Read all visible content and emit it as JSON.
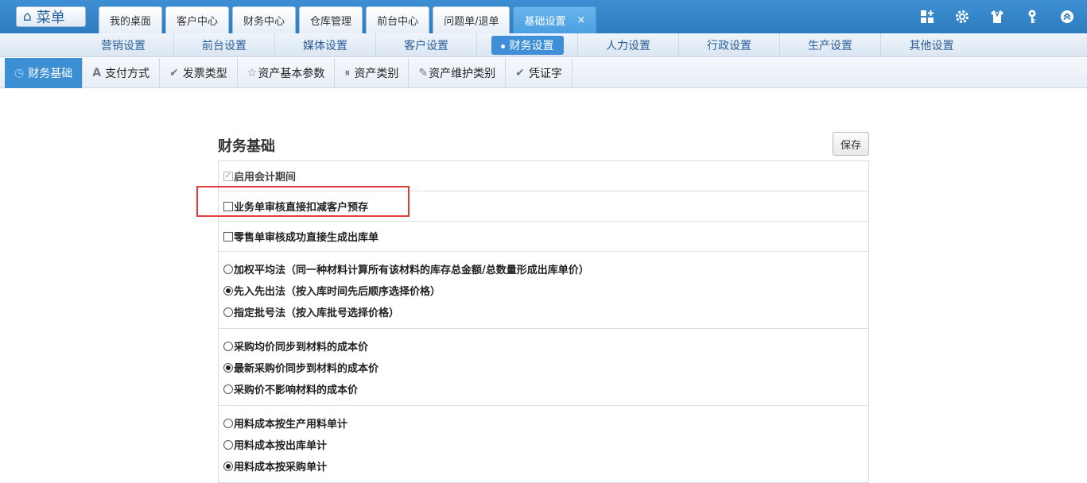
{
  "topbar": {
    "menu_label": "菜单",
    "tabs": [
      {
        "label": "我的桌面"
      },
      {
        "label": "客户中心"
      },
      {
        "label": "财务中心"
      },
      {
        "label": "仓库管理"
      },
      {
        "label": "前台中心"
      },
      {
        "label": "问题单/退单"
      },
      {
        "label": "基础设置",
        "close": "×"
      }
    ],
    "icons": [
      "grid-add-icon",
      "gear-icon",
      "shirt-icon",
      "key-icon",
      "collapse-up-icon"
    ]
  },
  "subbar": {
    "items": [
      {
        "label": "营销设置"
      },
      {
        "label": "前台设置"
      },
      {
        "label": "媒体设置"
      },
      {
        "label": "客户设置"
      },
      {
        "label": "财务设置"
      },
      {
        "label": "人力设置"
      },
      {
        "label": "行政设置"
      },
      {
        "label": "生产设置"
      },
      {
        "label": "其他设置"
      }
    ],
    "active": "财务设置"
  },
  "thirdbar": {
    "tabs": [
      {
        "label": "财务基础",
        "icon": "clock-icon"
      },
      {
        "label": "支付方式",
        "icon": "letter-a-icon"
      },
      {
        "label": "发票类型",
        "icon": "checkmark-icon"
      },
      {
        "label": "资产基本参数",
        "icon": "star-outline-icon"
      },
      {
        "label": "资产类别",
        "icon": "pause-circle-icon"
      },
      {
        "label": "资产维护类别",
        "icon": "pencil-icon"
      },
      {
        "label": "凭证字",
        "icon": "checkmark-icon"
      }
    ]
  },
  "content": {
    "title": "财务基础",
    "save_label": "保存",
    "checkbox_rows": [
      {
        "label": "启用会计期间",
        "checked": true,
        "disabled": true
      },
      {
        "label": "业务单审核直接扣减客户预存",
        "checked": false
      },
      {
        "label": "零售单审核成功直接生成出库单",
        "checked": false
      }
    ],
    "radio_groups": [
      {
        "options": [
          {
            "label": "加权平均法（同一种材料计算所有该材料的库存总金额/总数量形成出库单价）",
            "selected": false
          },
          {
            "label": "先入先出法（按入库时间先后顺序选择价格）",
            "selected": true
          },
          {
            "label": "指定批号法（按入库批号选择价格）",
            "selected": false
          }
        ]
      },
      {
        "options": [
          {
            "label": "采购均价同步到材料的成本价",
            "selected": false
          },
          {
            "label": "最新采购价同步到材料的成本价",
            "selected": true
          },
          {
            "label": "采购价不影响材料的成本价",
            "selected": false
          }
        ]
      },
      {
        "options": [
          {
            "label": "用料成本按生产用料单计",
            "selected": false
          },
          {
            "label": "用料成本按出库单计",
            "selected": false
          },
          {
            "label": "用料成本按采购单计",
            "selected": true
          }
        ]
      }
    ]
  }
}
